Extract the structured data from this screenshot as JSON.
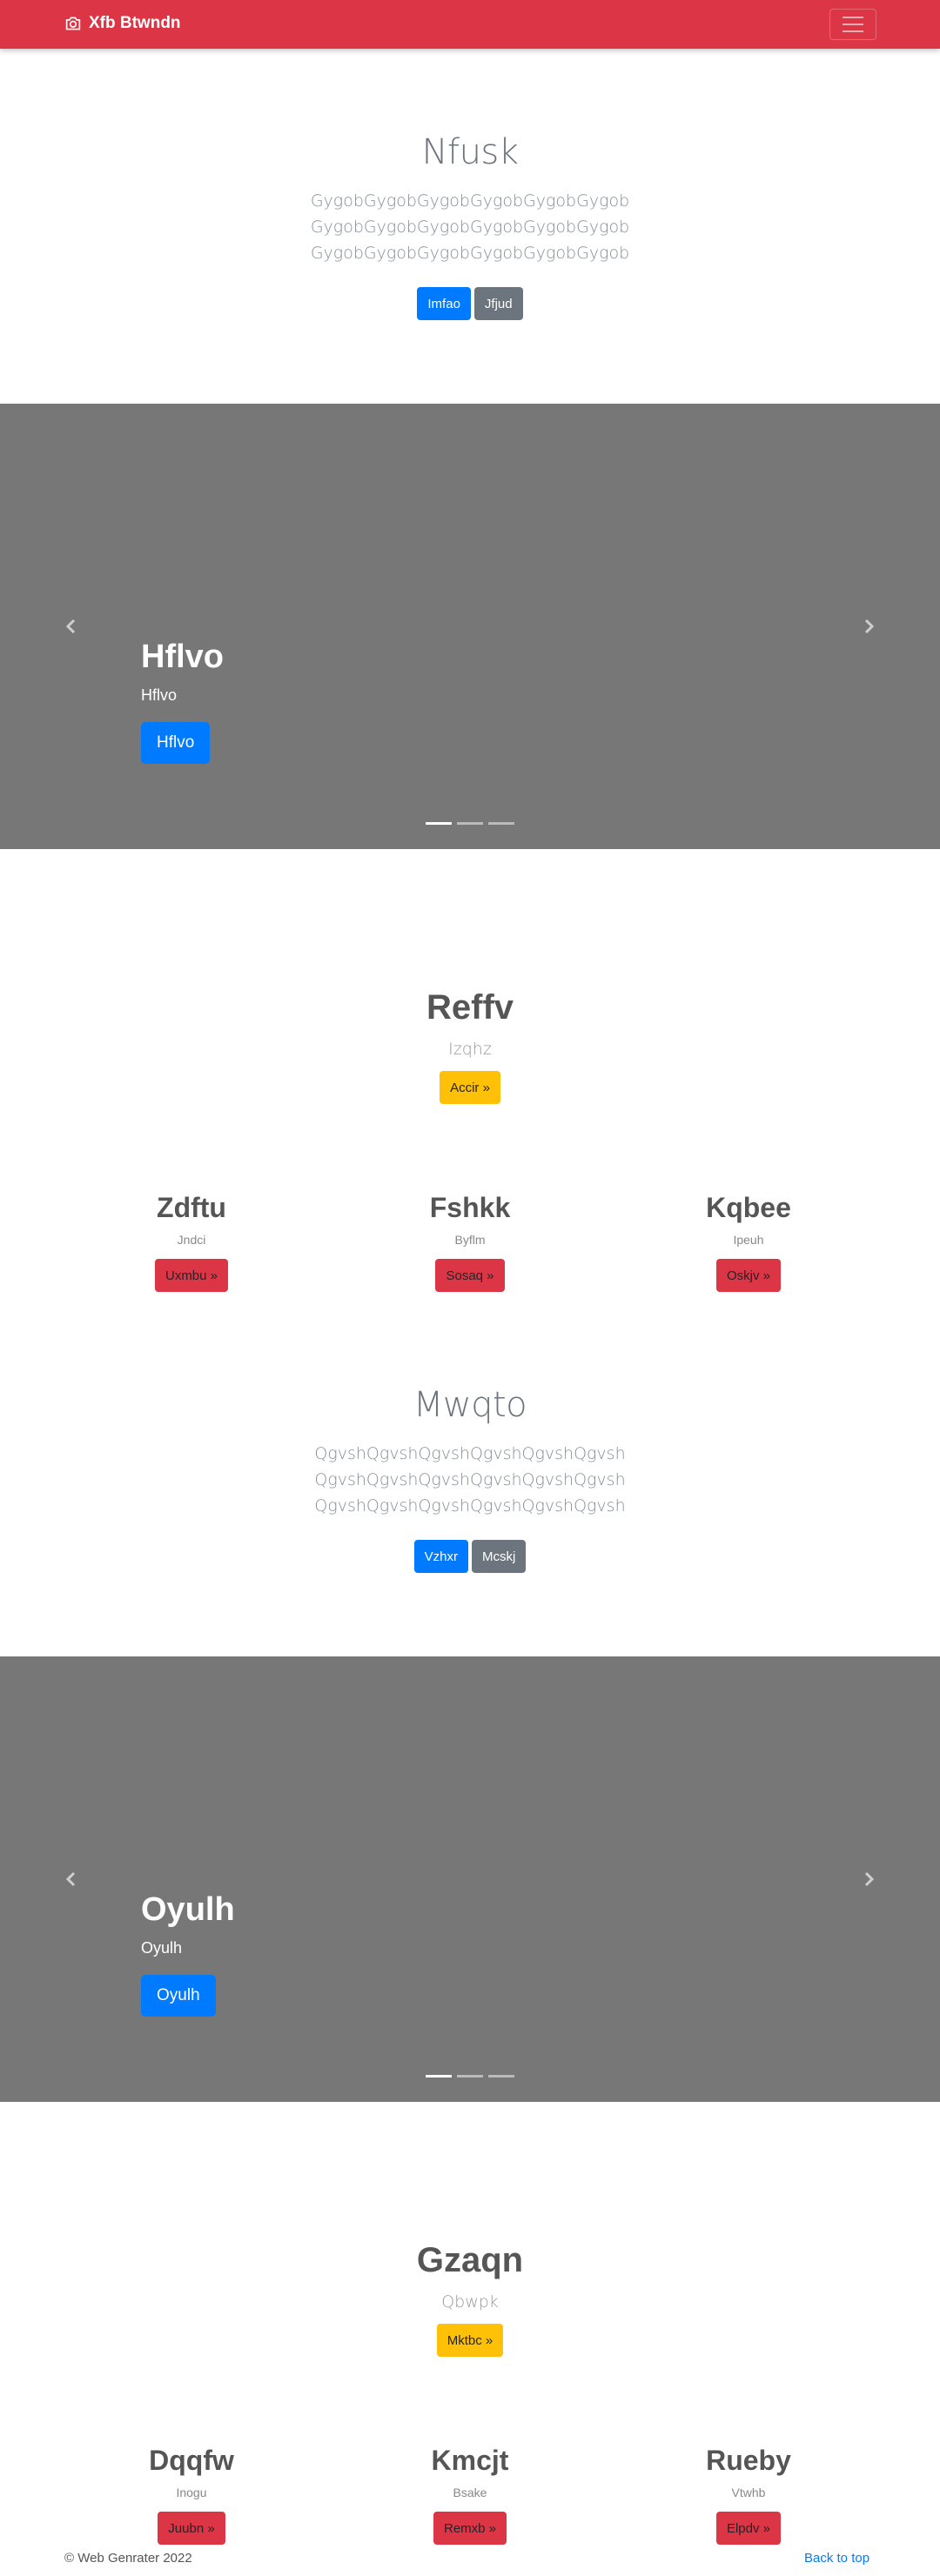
{
  "navbar": {
    "brand": "Xfb Btwndn",
    "brand_icon": "camera-icon",
    "toggler_icon": "hamburger-icon",
    "color": "#dc3545"
  },
  "hero1": {
    "title": "Nfusk",
    "lines": [
      "GygobGygobGygobGygobGygobGygob",
      "GygobGygobGygobGygobGygobGygob",
      "GygobGygobGygobGygobGygobGygob"
    ],
    "primary_label": "Imfao",
    "secondary_label": "Jfjud"
  },
  "carousel1": {
    "title": "Hflvo",
    "subtitle": "Hflvo",
    "button": "Hflvo",
    "indicator_count": 3,
    "active_index": 0
  },
  "marketing1": {
    "title": "Reffv",
    "subtitle": "Izqhz",
    "button": "Accir »"
  },
  "cols1": [
    {
      "title": "Zdftu",
      "sub": "Jndci",
      "button": "Uxmbu »"
    },
    {
      "title": "Fshkk",
      "sub": "Byflm",
      "button": "Sosaq »"
    },
    {
      "title": "Kqbee",
      "sub": "Ipeuh",
      "button": "Oskjv »"
    }
  ],
  "hero2": {
    "title": "Mwqto",
    "lines": [
      "QgvshQgvshQgvshQgvshQgvshQgvsh",
      "QgvshQgvshQgvshQgvshQgvshQgvsh",
      "QgvshQgvshQgvshQgvshQgvshQgvsh"
    ],
    "primary_label": "Vzhxr",
    "secondary_label": "Mcskj"
  },
  "carousel2": {
    "title": "Oyulh",
    "subtitle": "Oyulh",
    "button": "Oyulh",
    "indicator_count": 3,
    "active_index": 0
  },
  "marketing2": {
    "title": "Gzaqn",
    "subtitle": "Qbwpk",
    "button": "Mktbc »"
  },
  "cols2": [
    {
      "title": "Dqqfw",
      "sub": "Inogu",
      "button": "Juubn »"
    },
    {
      "title": "Kmcjt",
      "sub": "Bsake",
      "button": "Remxb »"
    },
    {
      "title": "Rueby",
      "sub": "Vtwhb",
      "button": "Elpdv »"
    }
  ],
  "footer": {
    "copyright": "© Web Genrater 2022",
    "back_to_top": "Back to top"
  }
}
